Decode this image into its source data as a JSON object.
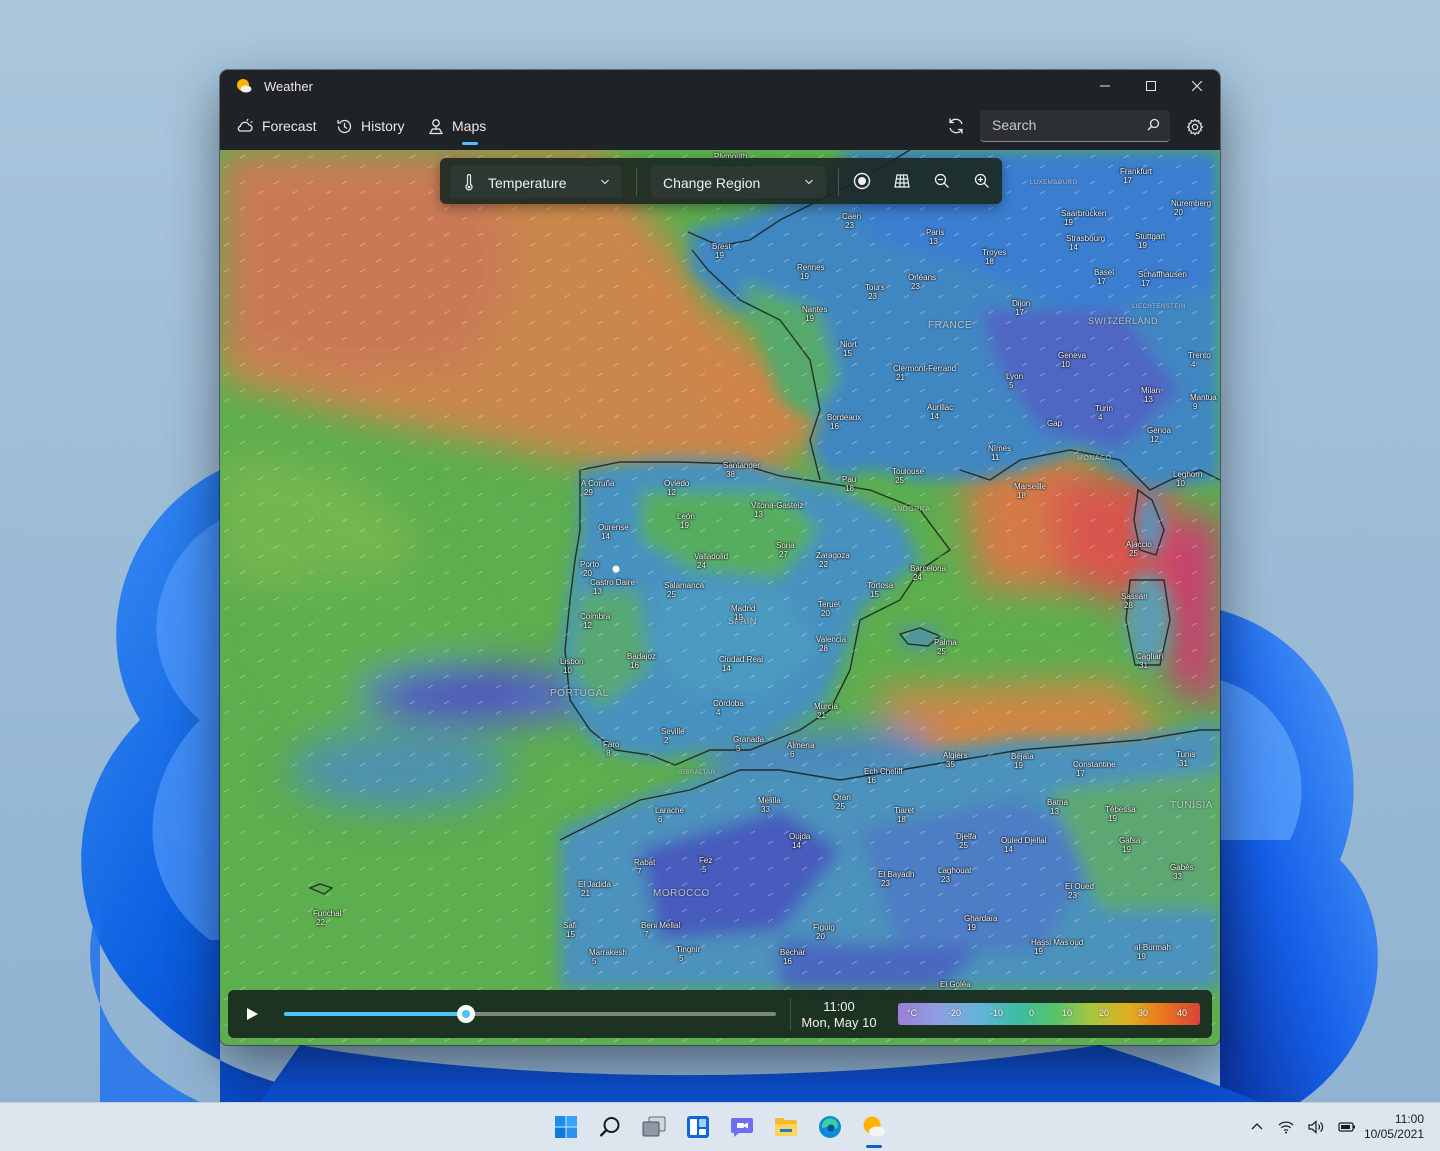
{
  "window": {
    "title": "Weather"
  },
  "nav": {
    "forecast": "Forecast",
    "history": "History",
    "maps": "Maps"
  },
  "search": {
    "placeholder": "Search"
  },
  "toolbar": {
    "layer_label": "Temperature",
    "region_label": "Change Region"
  },
  "timeline": {
    "time": "11:00",
    "date": "Mon, May 10",
    "progress": 0.37
  },
  "legend": {
    "unit": "°C",
    "ticks": [
      "-20",
      "-10",
      "0",
      "10",
      "20",
      "30",
      "40"
    ]
  },
  "colors": {
    "accent": "#4cc2ff",
    "window_bg": "#1f2328"
  },
  "countries": [
    "FRANCE",
    "SWITZERLAND",
    "PORTUGAL",
    "SPAIN",
    "MOROCCO",
    "TUNISIA",
    "MONACO",
    "ANDORRA",
    "LUXEMBOURG",
    "LIECHTENSTEIN",
    "GIBRALTAR"
  ],
  "cities": [
    {
      "name": "Plymouth",
      "value": ""
    },
    {
      "name": "Frankfurt",
      "value": "17"
    },
    {
      "name": "Caen",
      "value": "23"
    },
    {
      "name": "Paris",
      "value": "13"
    },
    {
      "name": "Saarbrücken",
      "value": "19"
    },
    {
      "name": "Nuremberg",
      "value": "20"
    },
    {
      "name": "Brest",
      "value": "19"
    },
    {
      "name": "Rennes",
      "value": "19"
    },
    {
      "name": "Troyes",
      "value": "18"
    },
    {
      "name": "Strasbourg",
      "value": "14"
    },
    {
      "name": "Stuttgart",
      "value": "19"
    },
    {
      "name": "Orléans",
      "value": "23"
    },
    {
      "name": "Tours",
      "value": "23"
    },
    {
      "name": "Basel",
      "value": "17"
    },
    {
      "name": "Schaffhausen",
      "value": "17"
    },
    {
      "name": "Nantes",
      "value": "19"
    },
    {
      "name": "Dijon",
      "value": "17"
    },
    {
      "name": "Niort",
      "value": "15"
    },
    {
      "name": "Geneva",
      "value": "10"
    },
    {
      "name": "Trento",
      "value": "4"
    },
    {
      "name": "Clermont-Ferrand",
      "value": "21"
    },
    {
      "name": "Lyon",
      "value": "5"
    },
    {
      "name": "Milan",
      "value": "13"
    },
    {
      "name": "Mantua",
      "value": "9"
    },
    {
      "name": "Aurillac",
      "value": "14"
    },
    {
      "name": "Bordeaux",
      "value": "16"
    },
    {
      "name": "Turin",
      "value": "4"
    },
    {
      "name": "Gap",
      "value": ""
    },
    {
      "name": "Genoa",
      "value": "12"
    },
    {
      "name": "Nîmes",
      "value": "11"
    },
    {
      "name": "Santander",
      "value": "38"
    },
    {
      "name": "Toulouse",
      "value": "25"
    },
    {
      "name": "Pau",
      "value": "18"
    },
    {
      "name": "Marseille",
      "value": "18"
    },
    {
      "name": "Leghorn",
      "value": "10"
    },
    {
      "name": "A Coruña",
      "value": "29"
    },
    {
      "name": "Oviedo",
      "value": "12"
    },
    {
      "name": "Vitoria-Gasteiz",
      "value": "13"
    },
    {
      "name": "León",
      "value": "19"
    },
    {
      "name": "Ourense",
      "value": "14"
    },
    {
      "name": "Ajaccio",
      "value": "25"
    },
    {
      "name": "Soria",
      "value": "27"
    },
    {
      "name": "Valladolid",
      "value": "24"
    },
    {
      "name": "Zaragoza",
      "value": "22"
    },
    {
      "name": "Barcelona",
      "value": "24"
    },
    {
      "name": "Porto",
      "value": "20"
    },
    {
      "name": "Castro Daire",
      "value": "13"
    },
    {
      "name": "Salamanca",
      "value": "25"
    },
    {
      "name": "Tortosa",
      "value": "15"
    },
    {
      "name": "Sassari",
      "value": "28"
    },
    {
      "name": "Madrid",
      "value": "19"
    },
    {
      "name": "Teruel",
      "value": "20"
    },
    {
      "name": "Coimbra",
      "value": "12"
    },
    {
      "name": "Valencia",
      "value": "28"
    },
    {
      "name": "Palma",
      "value": "25"
    },
    {
      "name": "Cagliari",
      "value": "31"
    },
    {
      "name": "Lisbon",
      "value": "10"
    },
    {
      "name": "Badajoz",
      "value": "16"
    },
    {
      "name": "Ciudad Real",
      "value": "14"
    },
    {
      "name": "Córdoba",
      "value": "4"
    },
    {
      "name": "Murcia",
      "value": "21"
    },
    {
      "name": "Seville",
      "value": "2"
    },
    {
      "name": "Faro",
      "value": "8"
    },
    {
      "name": "Granada",
      "value": "5"
    },
    {
      "name": "Almería",
      "value": "6"
    },
    {
      "name": "Algiers",
      "value": "35"
    },
    {
      "name": "Béjaïa",
      "value": "19"
    },
    {
      "name": "Tunis",
      "value": "31"
    },
    {
      "name": "Ech Cheliff",
      "value": "16"
    },
    {
      "name": "Constantine",
      "value": "17"
    },
    {
      "name": "Larache",
      "value": "6"
    },
    {
      "name": "Melilla",
      "value": "33"
    },
    {
      "name": "Oran",
      "value": "25"
    },
    {
      "name": "Tiaret",
      "value": "18"
    },
    {
      "name": "Batna",
      "value": "13"
    },
    {
      "name": "Tébessa",
      "value": "19"
    },
    {
      "name": "Oujda",
      "value": "14"
    },
    {
      "name": "Djelfa",
      "value": "25"
    },
    {
      "name": "Ouled Djellal",
      "value": "14"
    },
    {
      "name": "Gafsa",
      "value": "19"
    },
    {
      "name": "Rabat",
      "value": "7"
    },
    {
      "name": "Fez",
      "value": "5"
    },
    {
      "name": "El Bayadh",
      "value": "23"
    },
    {
      "name": "Laghouat",
      "value": "23"
    },
    {
      "name": "Gabès",
      "value": "33"
    },
    {
      "name": "El Jadida",
      "value": "21"
    },
    {
      "name": "El Oued",
      "value": "23"
    },
    {
      "name": "Funchal",
      "value": "22"
    },
    {
      "name": "Safi",
      "value": "15"
    },
    {
      "name": "Beni Mellal",
      "value": "7"
    },
    {
      "name": "Ghardaïa",
      "value": "19"
    },
    {
      "name": "Figuig",
      "value": "20"
    },
    {
      "name": "Marrakesh",
      "value": "5"
    },
    {
      "name": "Tinghir",
      "value": "5"
    },
    {
      "name": "Béchar",
      "value": "16"
    },
    {
      "name": "Hassi Mas'oud",
      "value": "19"
    },
    {
      "name": "al-Burmah",
      "value": "19"
    },
    {
      "name": "El Goléa",
      "value": ""
    }
  ],
  "taskbar": {
    "items": [
      {
        "icon": "windows-start-icon"
      },
      {
        "icon": "search-icon"
      },
      {
        "icon": "task-view-icon"
      },
      {
        "icon": "widgets-icon"
      },
      {
        "icon": "teams-chat-icon"
      },
      {
        "icon": "file-explorer-icon"
      },
      {
        "icon": "edge-browser-icon"
      },
      {
        "icon": "weather-app-icon"
      }
    ],
    "time": "11:00",
    "date": "10/05/2021"
  }
}
